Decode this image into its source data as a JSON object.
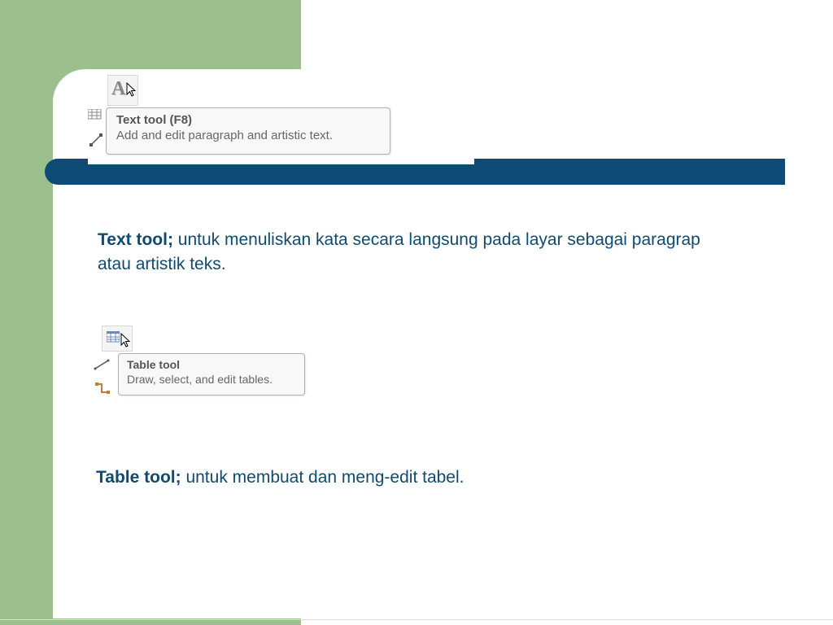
{
  "tooltip1": {
    "title": "Text tool (F8)",
    "desc": "Add and edit paragraph and artistic text."
  },
  "tooltip2": {
    "title": "Table tool",
    "desc": "Draw, select, and edit tables."
  },
  "desc1": {
    "bold": "Text tool;",
    "rest": " untuk menuliskan kata secara langsung pada layar sebagai paragrap atau artistik teks."
  },
  "desc2": {
    "bold": "Table tool;",
    "rest": " untuk membuat dan meng-edit tabel."
  }
}
